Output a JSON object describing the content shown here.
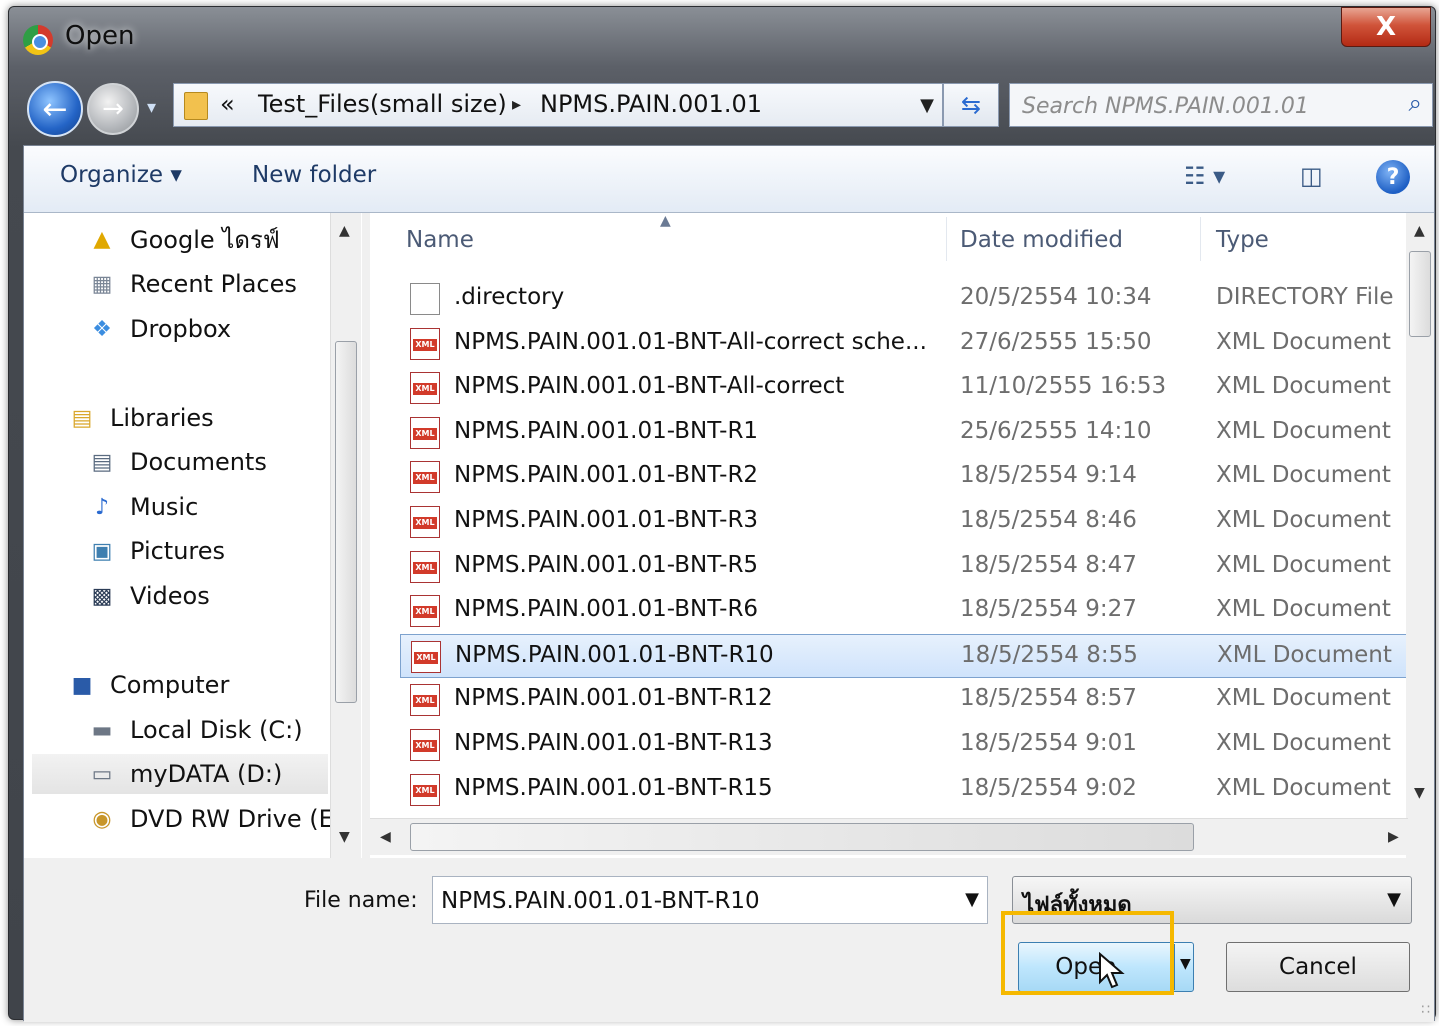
{
  "window": {
    "title": "Open",
    "close_label": "X"
  },
  "nav_buttons": {
    "back_icon": "back-arrow-icon",
    "forward_icon": "forward-arrow-icon"
  },
  "address": {
    "overflow": "«",
    "crumbs": [
      "Test_Files(small size)",
      "NPMS.PAIN.001.01"
    ]
  },
  "search": {
    "placeholder": "Search NPMS.PAIN.001.01"
  },
  "toolbar": {
    "organize": "Organize",
    "new_folder": "New folder"
  },
  "nav_pane": {
    "items": [
      {
        "label": "Google ไดรฟ์",
        "icon": "google-drive-icon"
      },
      {
        "label": "Recent Places",
        "icon": "recent-places-icon"
      },
      {
        "label": "Dropbox",
        "icon": "dropbox-icon"
      },
      {
        "label": "Libraries",
        "icon": "libraries-icon"
      },
      {
        "label": "Documents",
        "icon": "documents-icon"
      },
      {
        "label": "Music",
        "icon": "music-icon"
      },
      {
        "label": "Pictures",
        "icon": "pictures-icon"
      },
      {
        "label": "Videos",
        "icon": "videos-icon"
      },
      {
        "label": "Computer",
        "icon": "computer-icon"
      },
      {
        "label": "Local Disk (C:)",
        "icon": "local-disk-icon"
      },
      {
        "label": "myDATA (D:)",
        "icon": "drive-icon"
      },
      {
        "label": "DVD RW Drive (E:",
        "icon": "dvd-drive-icon"
      }
    ]
  },
  "columns": {
    "name": "Name",
    "date": "Date modified",
    "type": "Type"
  },
  "files": [
    {
      "name": ".directory",
      "date": "20/5/2554 10:34",
      "type": "DIRECTORY File",
      "kind": "blank"
    },
    {
      "name": "NPMS.PAIN.001.01-BNT-All-correct sche...",
      "date": "27/6/2555 15:50",
      "type": "XML Document",
      "kind": "xml"
    },
    {
      "name": "NPMS.PAIN.001.01-BNT-All-correct",
      "date": "11/10/2555 16:53",
      "type": "XML Document",
      "kind": "xml"
    },
    {
      "name": "NPMS.PAIN.001.01-BNT-R1",
      "date": "25/6/2555 14:10",
      "type": "XML Document",
      "kind": "xml"
    },
    {
      "name": "NPMS.PAIN.001.01-BNT-R2",
      "date": "18/5/2554 9:14",
      "type": "XML Document",
      "kind": "xml"
    },
    {
      "name": "NPMS.PAIN.001.01-BNT-R3",
      "date": "18/5/2554 8:46",
      "type": "XML Document",
      "kind": "xml"
    },
    {
      "name": "NPMS.PAIN.001.01-BNT-R5",
      "date": "18/5/2554 8:47",
      "type": "XML Document",
      "kind": "xml"
    },
    {
      "name": "NPMS.PAIN.001.01-BNT-R6",
      "date": "18/5/2554 9:27",
      "type": "XML Document",
      "kind": "xml"
    },
    {
      "name": "NPMS.PAIN.001.01-BNT-R10",
      "date": "18/5/2554 8:55",
      "type": "XML Document",
      "kind": "xml",
      "selected": true
    },
    {
      "name": "NPMS.PAIN.001.01-BNT-R12",
      "date": "18/5/2554 8:57",
      "type": "XML Document",
      "kind": "xml"
    },
    {
      "name": "NPMS.PAIN.001.01-BNT-R13",
      "date": "18/5/2554 9:01",
      "type": "XML Document",
      "kind": "xml"
    },
    {
      "name": "NPMS.PAIN.001.01-BNT-R15",
      "date": "18/5/2554 9:02",
      "type": "XML Document",
      "kind": "xml"
    }
  ],
  "footer": {
    "file_name_label": "File name:",
    "file_name_value": "NPMS.PAIN.001.01-BNT-R10",
    "file_type_value": "ไฟล์ทั้งหมด",
    "open_label": "Open",
    "cancel_label": "Cancel"
  },
  "colors": {
    "highlight": "#f5b800",
    "selection": "#cfe3fb",
    "accent": "#1e5fc4"
  }
}
